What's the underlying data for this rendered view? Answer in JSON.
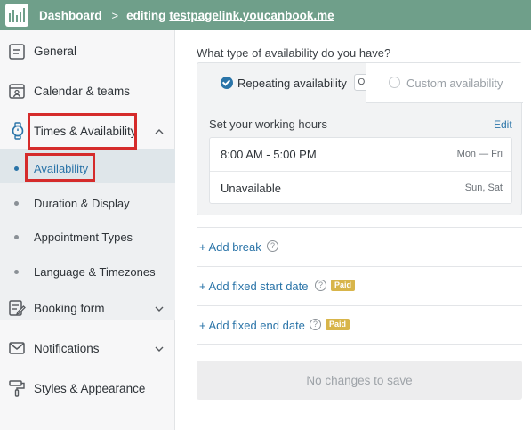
{
  "header": {
    "home_label": "Dashboard",
    "separator": ">",
    "editing_label": "editing",
    "page_link": "testpagelink.youcanbook.me"
  },
  "sidebar": {
    "items": [
      {
        "label": "General",
        "icon": "general-icon"
      },
      {
        "label": "Calendar & teams",
        "icon": "calendar-icon"
      },
      {
        "label": "Times & Availability",
        "icon": "watch-icon",
        "expanded": true
      },
      {
        "label": "Booking form",
        "icon": "form-icon"
      },
      {
        "label": "Notifications",
        "icon": "mail-icon"
      },
      {
        "label": "Styles & Appearance",
        "icon": "paint-roller-icon"
      }
    ],
    "subitems": [
      {
        "label": "Availability",
        "active": true
      },
      {
        "label": "Duration & Display"
      },
      {
        "label": "Appointment Types"
      },
      {
        "label": "Language & Timezones"
      }
    ]
  },
  "main": {
    "question": "What type of availability do you have?",
    "option_repeating": "Repeating availability",
    "or_label": "OR",
    "option_custom": "Custom availability",
    "working_hours_label": "Set your working hours",
    "edit_label": "Edit",
    "hours": [
      {
        "time": "8:00 AM - 5:00 PM",
        "days": "Mon — Fri"
      },
      {
        "time": "Unavailable",
        "days": "Sun, Sat"
      }
    ],
    "add_break": "+ Add break",
    "add_start": "+ Add fixed start date",
    "add_end": "+ Add fixed end date",
    "paid_label": "Paid",
    "help_glyph": "?",
    "save_label": "No changes to save"
  },
  "colors": {
    "topbar": "#6f9f8a",
    "link": "#2a74a8",
    "annotation": "#d52b2b",
    "paid": "#d8b54a"
  }
}
